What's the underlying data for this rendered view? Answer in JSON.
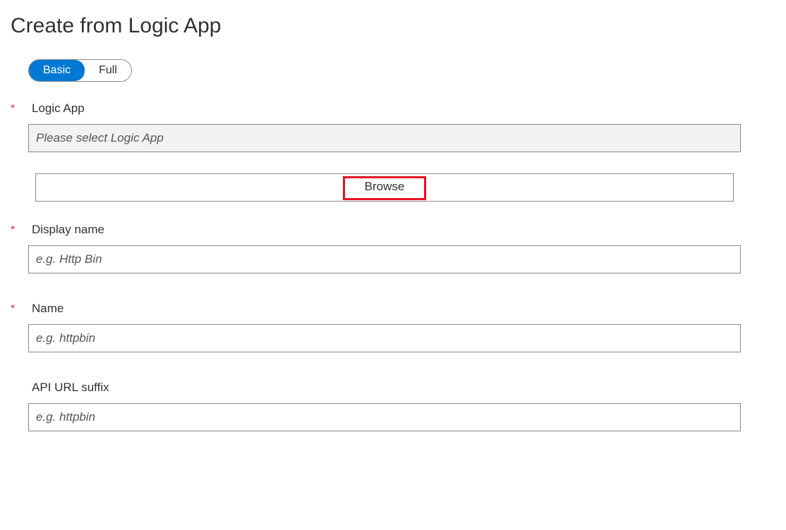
{
  "page": {
    "title": "Create from Logic App"
  },
  "toggle": {
    "basic": "Basic",
    "full": "Full"
  },
  "fields": {
    "logicApp": {
      "label": "Logic App",
      "placeholder": "Please select Logic App",
      "required": true
    },
    "browse": {
      "label": "Browse"
    },
    "displayName": {
      "label": "Display name",
      "placeholder": "e.g. Http Bin",
      "required": true
    },
    "name": {
      "label": "Name",
      "placeholder": "e.g. httpbin",
      "required": true
    },
    "apiUrlSuffix": {
      "label": "API URL suffix",
      "placeholder": "e.g. httpbin",
      "required": false
    }
  },
  "markers": {
    "required": "*"
  }
}
